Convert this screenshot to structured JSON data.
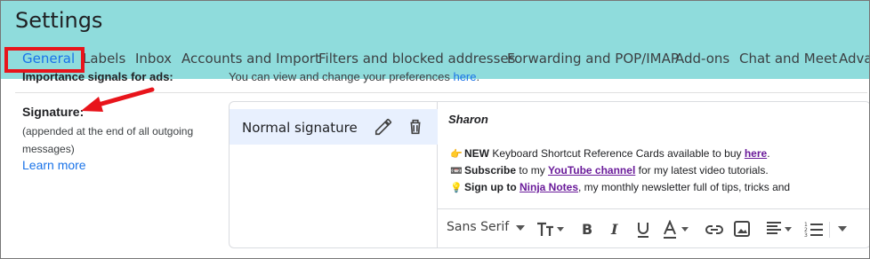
{
  "header": {
    "title": "Settings",
    "tabs": [
      {
        "label": "General",
        "active": true
      },
      {
        "label": "Labels"
      },
      {
        "label": "Inbox"
      },
      {
        "label": "Accounts and Import"
      },
      {
        "label": "Filters and blocked addresses"
      },
      {
        "label": "Forwarding and POP/IMAP"
      },
      {
        "label": "Add-ons"
      },
      {
        "label": "Chat and Meet"
      },
      {
        "label": "Adva"
      }
    ]
  },
  "importance": {
    "label": "Importance signals for ads:",
    "desc": "You can view and change your preferences ",
    "link": "here",
    "suffix": "."
  },
  "signature": {
    "label": "Signature:",
    "desc": "(appended at the end of all outgoing messages)",
    "learn_more": "Learn more",
    "list": [
      {
        "name": "Normal signature"
      }
    ],
    "editor": {
      "name": "Sharon",
      "lines": [
        {
          "emoji": "👉",
          "bold": "NEW",
          "text1": " Keyboard Shortcut Reference Cards available to buy ",
          "link": "here",
          "text2": "."
        },
        {
          "emoji": "📼",
          "bold": "Subscribe",
          "text1": " to my ",
          "link": "YouTube channel",
          "text2": " for my latest video tutorials."
        },
        {
          "emoji": "💡",
          "bold": "Sign up to",
          "text1": " ",
          "link": "Ninja Notes",
          "text2": ", my monthly newsletter full of tips, tricks and"
        }
      ]
    },
    "toolbar": {
      "font": "Sans Serif"
    }
  },
  "colors": {
    "header_bg": "#8fdcdc",
    "active_tab": "#1a73e8",
    "highlight": "#e8141b",
    "selected_item_bg": "#e8f0fe"
  }
}
